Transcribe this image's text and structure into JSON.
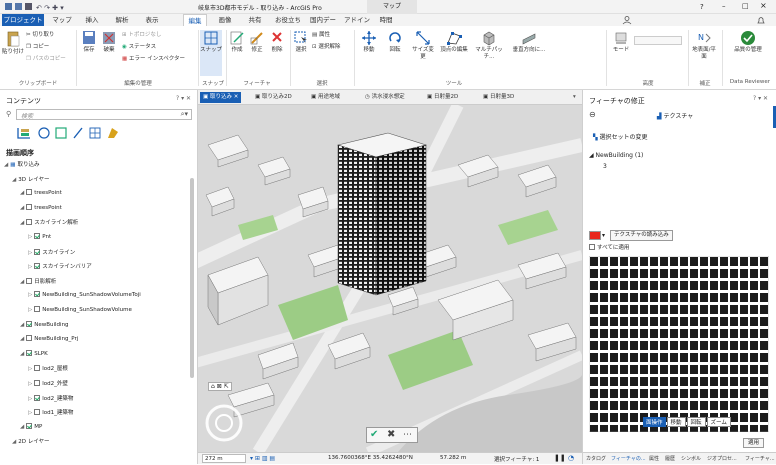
{
  "window": {
    "title": "岐阜市3D都市モデル - 取り込み - ArcGIS Pro",
    "context_tab": "マップ",
    "help": "?",
    "minimize": "–",
    "maximize": "□",
    "close": "×"
  },
  "tabs": [
    "プロジェクト",
    "マップ",
    "挿入",
    "解析",
    "表示",
    "編集",
    "画像",
    "共有",
    "お役立ち",
    "国内データ",
    "アドイン",
    "時間"
  ],
  "active_tab": "プロジェクト",
  "ribbon": {
    "clipboard": {
      "paste": "貼り付け",
      "cut": "切り取り",
      "copy": "コピー",
      "copy_path": "パスのコピー",
      "label": "クリップボード"
    },
    "manage_edits": {
      "save": "保存",
      "discard": "破棄",
      "toggle": "トポロジなし",
      "status": "ステータス",
      "inspector": "エラー インスペクター",
      "label": "編集の管理"
    },
    "snapping": {
      "snap": "スナップ",
      "label": "スナップ"
    },
    "features": {
      "create": "作成",
      "modify": "修正",
      "delete": "削除",
      "label": "フィーチャ"
    },
    "selection": {
      "select": "選択",
      "attributes": "属性",
      "clear": "選択解除",
      "label": "選択"
    },
    "tools": {
      "move": "移動",
      "rotate": "回転",
      "scale": "サイズ変更",
      "vertices": "頂点の編集",
      "multipatch": "マルチパッチ...",
      "direction": "垂直方向に...",
      "label": "ツール"
    },
    "elevation": {
      "label": "高度",
      "mode": "モード"
    },
    "correction": {
      "ground": "地表面/平面",
      "label": "補正"
    },
    "quality": {
      "manage": "品質の管理",
      "label": "Data Reviewer"
    }
  },
  "contents": {
    "title": "コンテンツ",
    "search_placeholder": "検索",
    "section": "描画順序",
    "items": [
      {
        "label": "取り込み",
        "indent": 0,
        "type": "map"
      },
      {
        "label": "3D レイヤー",
        "indent": 1,
        "type": "group"
      },
      {
        "label": "treesPoint",
        "indent": 2,
        "checked": false
      },
      {
        "label": "treesPoint",
        "indent": 2,
        "checked": false
      },
      {
        "label": "スカイライン解析",
        "indent": 2,
        "checked": false
      },
      {
        "label": "Pnt",
        "indent": 3,
        "checked": true
      },
      {
        "label": "スカイライン",
        "indent": 3,
        "checked": true
      },
      {
        "label": "スカイラインバリア",
        "indent": 3,
        "checked": true
      },
      {
        "label": "日影解析",
        "indent": 2,
        "checked": false
      },
      {
        "label": "NewBuilding_SunShadowVolumeToji",
        "indent": 3,
        "checked": true
      },
      {
        "label": "NewBuilding_SunShadowVolume",
        "indent": 3,
        "checked": false
      },
      {
        "label": "NewBuilding",
        "indent": 2,
        "checked": true
      },
      {
        "label": "NewBuilding_Prj",
        "indent": 2,
        "checked": false
      },
      {
        "label": "SLPK",
        "indent": 2,
        "checked": true
      },
      {
        "label": "lod2_屋根",
        "indent": 3,
        "checked": false
      },
      {
        "label": "lod2_外壁",
        "indent": 3,
        "checked": false
      },
      {
        "label": "lod2_建築物",
        "indent": 3,
        "checked": true
      },
      {
        "label": "lod1_建築物",
        "indent": 3,
        "checked": false
      },
      {
        "label": "MP",
        "indent": 2,
        "checked": true
      },
      {
        "label": "2D レイヤー",
        "indent": 1,
        "type": "group"
      }
    ]
  },
  "map_tabs": [
    "取り込み",
    "取り込み2D",
    "用途地域",
    "洪水浸水想定",
    "日射量2D",
    "日射量3D"
  ],
  "map": {
    "time_button": "時間",
    "scale": "272 m",
    "coords": "136.7600368°E 35.4262480°N",
    "elevation": "57.282 m",
    "selected": "選択フィーチャ: 1"
  },
  "modify_panel": {
    "title": "フィーチャの修正",
    "tool": "テクスチャ",
    "change_set": "選択セットの変更",
    "layer": "NewBuilding (1)",
    "feature_id": "3",
    "load_texture": "テクスチャの読み込み",
    "apply_all": "すべてに適用",
    "modes": [
      "面操作",
      "移動",
      "回転",
      "ズーム"
    ],
    "apply": "適用",
    "bottom_tabs": [
      "カタログ",
      "フィーチャの...",
      "属性",
      "履歴",
      "シンボル",
      "ジオプロセ...",
      "フィーチャ..."
    ]
  },
  "colors": {
    "accent": "#1a5fb4",
    "texture_swatch": "#e8281e",
    "building": "#2b2b2b",
    "grass": "#9ccc85"
  }
}
